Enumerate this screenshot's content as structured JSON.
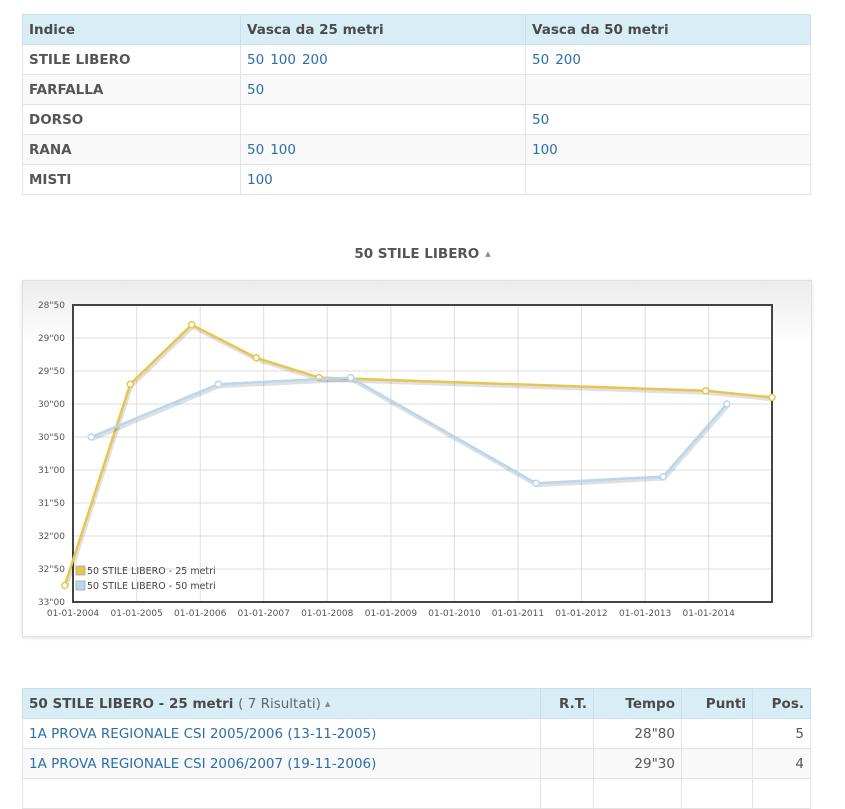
{
  "index_table": {
    "headers": [
      "Indice",
      "Vasca da 25 metri",
      "Vasca da 50 metri"
    ],
    "rows": [
      {
        "style": "STILE LIBERO",
        "pool25": [
          "50",
          "100",
          "200"
        ],
        "pool50": [
          "50",
          "200"
        ]
      },
      {
        "style": "FARFALLA",
        "pool25": [
          "50"
        ],
        "pool50": []
      },
      {
        "style": "DORSO",
        "pool25": [],
        "pool50": [
          "50"
        ]
      },
      {
        "style": "RANA",
        "pool25": [
          "50",
          "100"
        ],
        "pool50": [
          "100"
        ]
      },
      {
        "style": "MISTI",
        "pool25": [
          "100"
        ],
        "pool50": []
      }
    ]
  },
  "chart_title": "50 STILE LIBERO",
  "chart_data": {
    "type": "line",
    "x_ticks": [
      "01-01-2004",
      "01-01-2005",
      "01-01-2006",
      "01-01-2007",
      "01-01-2008",
      "01-01-2009",
      "01-01-2010",
      "01-01-2011",
      "01-01-2012",
      "01-01-2013",
      "01-01-2014"
    ],
    "x_range": [
      "2004-01-01",
      "2014-12-31"
    ],
    "y_ticks": [
      "28\"50",
      "29\"00",
      "29\"50",
      "30\"00",
      "30\"50",
      "31\"00",
      "31\"50",
      "32\"00",
      "32\"50",
      "33\"00"
    ],
    "ylim": [
      28.5,
      33.0
    ],
    "y_inverted": true,
    "grid": true,
    "legend_placement": "bottom-left",
    "series": [
      {
        "name": "50 STILE LIBERO - 25 metri",
        "color": "#e8c54e",
        "points": [
          {
            "x": "2003-11-15",
            "y": 32.75
          },
          {
            "x": "2004-11-25",
            "y": 29.7
          },
          {
            "x": "2005-11-13",
            "y": 28.8
          },
          {
            "x": "2006-11-19",
            "y": 29.3
          },
          {
            "x": "2007-11-15",
            "y": 29.6
          },
          {
            "x": "2013-12-15",
            "y": 29.8
          },
          {
            "x": "2014-12-31",
            "y": 29.9
          }
        ]
      },
      {
        "name": "50 STILE LIBERO - 50 metri",
        "color": "#b9d7ee",
        "points": [
          {
            "x": "2004-04-15",
            "y": 30.5
          },
          {
            "x": "2006-04-15",
            "y": 29.7
          },
          {
            "x": "2008-05-15",
            "y": 29.6
          },
          {
            "x": "2011-04-15",
            "y": 31.2
          },
          {
            "x": "2013-04-15",
            "y": 31.1
          },
          {
            "x": "2014-04-15",
            "y": 30.0
          }
        ]
      }
    ]
  },
  "results_table": {
    "title": "50 STILE LIBERO - 25 metri",
    "count": "( 7 Risultati)",
    "columns": {
      "rt": "R.T.",
      "tempo": "Tempo",
      "punti": "Punti",
      "pos": "Pos."
    },
    "rows": [
      {
        "event": "1A PROVA REGIONALE CSI 2005/2006 (13-11-2005)",
        "rt": "",
        "tempo": "28\"80",
        "punti": "",
        "pos": "5"
      },
      {
        "event": "1A PROVA REGIONALE CSI 2006/2007 (19-11-2006)",
        "rt": "",
        "tempo": "29\"30",
        "punti": "",
        "pos": "4"
      },
      {
        "event": "",
        "rt": "",
        "tempo": "",
        "punti": "",
        "pos": ""
      }
    ]
  }
}
